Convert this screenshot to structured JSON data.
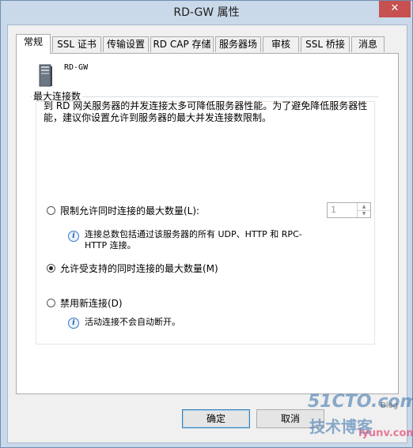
{
  "window": {
    "title": "RD-GW 属性",
    "close_label": "✕"
  },
  "tabs": [
    {
      "label": "常规",
      "active": true
    },
    {
      "label": "SSL 证书",
      "active": false
    },
    {
      "label": "传输设置",
      "active": false
    },
    {
      "label": "RD CAP 存储",
      "active": false
    },
    {
      "label": "服务器场",
      "active": false
    },
    {
      "label": "审核",
      "active": false
    },
    {
      "label": "SSL 桥接",
      "active": false
    },
    {
      "label": "消息",
      "active": false
    }
  ],
  "general": {
    "server_icon": "server-icon",
    "server_name": "RD-GW",
    "group_title": "最大连接数",
    "description": "到 RD 网关服务器的并发连接太多可降低服务器性能。为了避免降低服务器性能，建议你设置允许到服务器的最大并发连接数限制。",
    "options": {
      "limit": {
        "label": "限制允许同时连接的最大数量(L):",
        "selected": false,
        "spinner_value": "1",
        "info": "连接总数包括通过该服务器的所有 UDP、HTTP 和 RPC-HTTP 连接。"
      },
      "max_supported": {
        "label": "允许受支持的同时连接的最大数量(M)",
        "selected": true
      },
      "disable_new": {
        "label": "禁用新连接(D)",
        "selected": false,
        "info": "活动连接不会自动断开。"
      }
    }
  },
  "buttons": {
    "ok": "确定",
    "cancel": "取消"
  },
  "watermark": {
    "main": "51CTO.com",
    "sub": "技术博客",
    "blog": "Blog",
    "url": "lyunv.com"
  },
  "colors": {
    "titlebar": "#c9d9ea",
    "close": "#c75050",
    "default_button_border": "#3c7fb1"
  }
}
